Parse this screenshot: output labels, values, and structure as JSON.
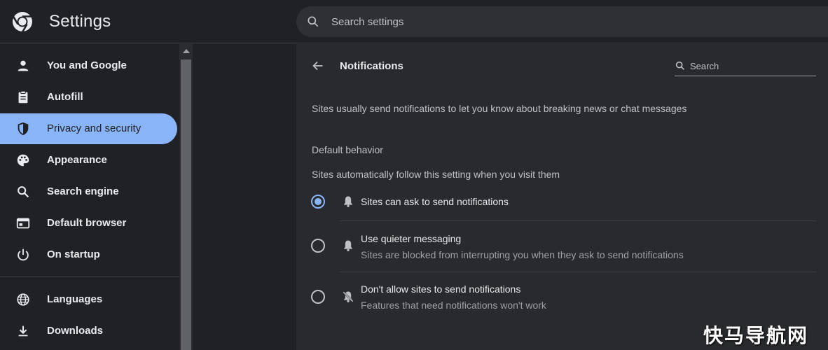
{
  "header": {
    "title": "Settings",
    "search_placeholder": "Search settings",
    "logo_icon": "chrome-logo-icon",
    "search_icon": "search-icon"
  },
  "sidebar": {
    "items": [
      {
        "label": "You and Google",
        "icon": "person-icon",
        "active": false
      },
      {
        "label": "Autofill",
        "icon": "clipboard-icon",
        "active": false
      },
      {
        "label": "Privacy and security",
        "icon": "shield-icon",
        "active": true
      },
      {
        "label": "Appearance",
        "icon": "palette-icon",
        "active": false
      },
      {
        "label": "Search engine",
        "icon": "search-icon",
        "active": false
      },
      {
        "label": "Default browser",
        "icon": "browser-window-icon",
        "active": false
      },
      {
        "label": "On startup",
        "icon": "power-icon",
        "active": false
      },
      {
        "label": "Languages",
        "icon": "globe-icon",
        "active": false
      },
      {
        "label": "Downloads",
        "icon": "download-icon",
        "active": false
      }
    ]
  },
  "panel": {
    "title": "Notifications",
    "search_placeholder": "Search",
    "description": "Sites usually send notifications to let you know about breaking news or chat messages",
    "default_behavior": {
      "heading": "Default behavior",
      "subheading": "Sites automatically follow this setting when you visit them",
      "options": [
        {
          "title": "Sites can ask to send notifications",
          "subtitle": "",
          "icon": "bell-icon",
          "selected": true
        },
        {
          "title": "Use quieter messaging",
          "subtitle": "Sites are blocked from interrupting you when they ask to send notifications",
          "icon": "bell-icon",
          "selected": false
        },
        {
          "title": "Don't allow sites to send notifications",
          "subtitle": "Features that need notifications won't work",
          "icon": "bell-off-icon",
          "selected": false
        }
      ]
    }
  },
  "watermark": "快马导航网",
  "colors": {
    "accent": "#8ab4f8",
    "background": "#202124",
    "panel": "#292a2d",
    "text": "#e8eaed",
    "secondary_text": "#bdc1c6"
  }
}
